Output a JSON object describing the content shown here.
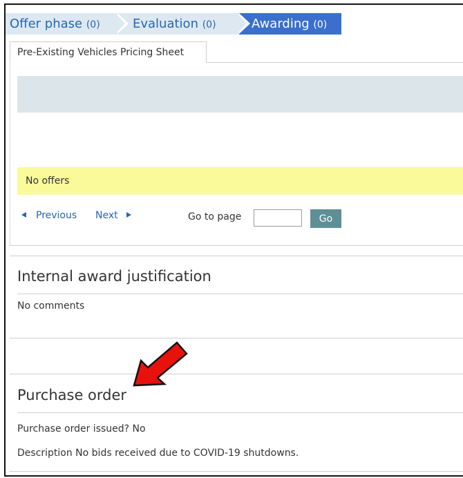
{
  "phases": [
    {
      "label": "Offer phase",
      "count": "(0)"
    },
    {
      "label": "Evaluation",
      "count": "(0)"
    },
    {
      "label": "Awarding",
      "count": "(0)"
    }
  ],
  "active_phase": "Awarding",
  "tab": {
    "label": "Pre-Existing Vehicles Pricing Sheet"
  },
  "offers": {
    "empty_message": "No offers"
  },
  "pager": {
    "previous": "Previous",
    "next": "Next",
    "goto_label": "Go to page",
    "goto_value": "",
    "go_button": "Go"
  },
  "justification": {
    "title": "Internal award justification",
    "comment": "No comments"
  },
  "purchase_order": {
    "title": "Purchase order",
    "issued_line": "Purchase order issued? No",
    "description_line": "Description No bids received due to COVID-19 shutdowns."
  },
  "colors": {
    "active_step": "#3a6fce",
    "inactive_step": "#dde8f1",
    "link": "#2566b3",
    "notice": "#fafa9a",
    "go_button": "#5e8f97",
    "annotation_arrow": "#e8120c"
  },
  "icons": [
    "arrow-left-icon",
    "arrow-right-icon",
    "red-annotation-arrow-icon"
  ]
}
